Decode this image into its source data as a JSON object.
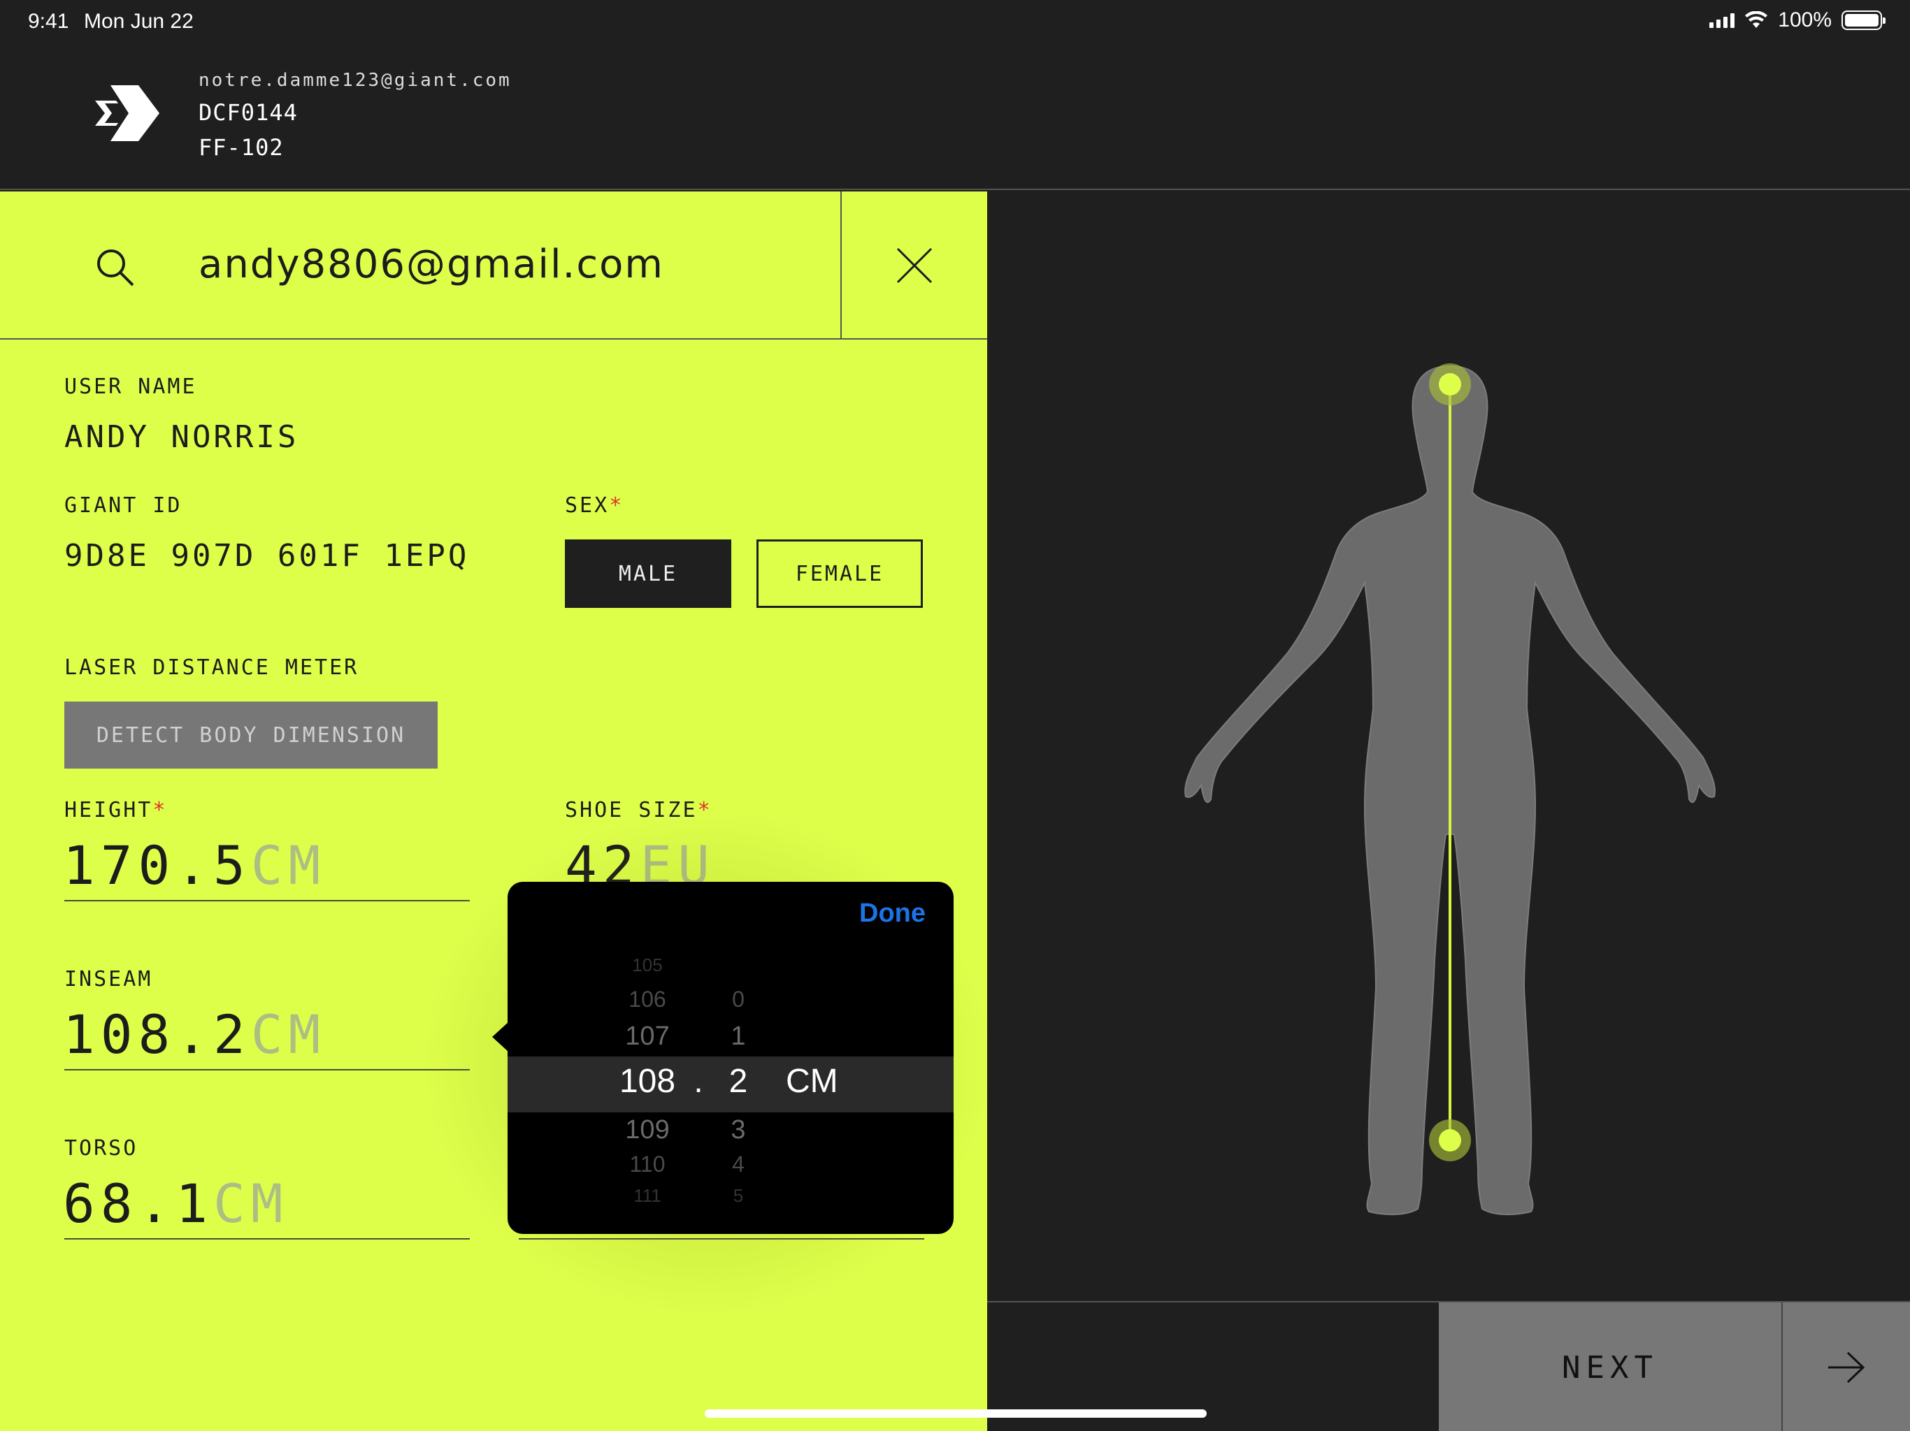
{
  "status_bar": {
    "time": "9:41",
    "date": "Mon Jun 22",
    "battery": "100%"
  },
  "account": {
    "email": "notre.damme123@giant.com",
    "dealer_code": "DCF0144",
    "station": "FF-102"
  },
  "search": {
    "value": "andy8806@gmail.com"
  },
  "form": {
    "user_name_label": "USER NAME",
    "user_name": "ANDY NORRIS",
    "giant_id_label": "GIANT ID",
    "giant_id": "9D8E 907D 601F 1EPQ",
    "sex_label": "SEX",
    "required_mark": "*",
    "sex_options": [
      "MALE",
      "FEMALE"
    ],
    "sex_selected": "MALE",
    "laser_label": "LASER DISTANCE METER",
    "detect_button": "DETECT BODY DIMENSION",
    "height_label": "HEIGHT",
    "height_value": "170.5",
    "height_unit": "CM",
    "shoe_label": "SHOE SIZE",
    "shoe_value": "42",
    "shoe_unit": "EU",
    "inseam_label": "INSEAM",
    "inseam_value": "108.2",
    "inseam_unit": "CM",
    "torso_label": "TORSO",
    "torso_value": "68.1",
    "torso_unit": "CM"
  },
  "picker": {
    "done_label": "Done",
    "integer_wheel": [
      "105",
      "106",
      "107",
      "108",
      "109",
      "110",
      "111"
    ],
    "decimal_wheel": [
      "0",
      "1",
      "2",
      "3",
      "4",
      "5"
    ],
    "selected_integer": "108",
    "selected_decimal": "2",
    "separator": ".",
    "unit": "CM"
  },
  "colors": {
    "accent": "#deff4a",
    "dark": "#1f1f1f",
    "done_blue": "#1b74e8",
    "required": "#e0342c"
  },
  "actions": {
    "next_label": "NEXT"
  }
}
